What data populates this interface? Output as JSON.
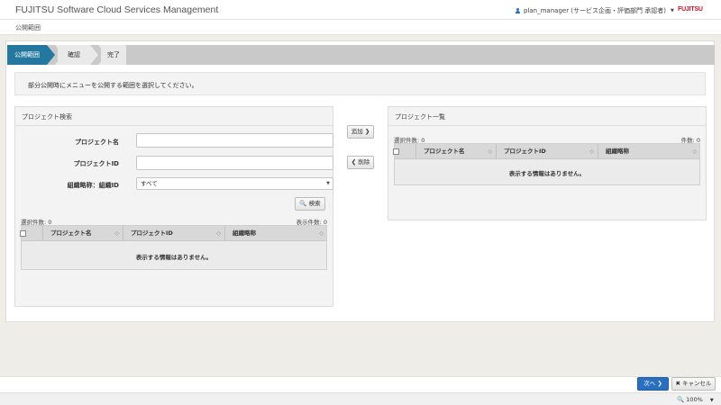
{
  "header": {
    "app_title": "FUJITSU Software Cloud Services Management",
    "user": "plan_manager (サービス企画・評価部門 承認者)",
    "logo": "FUJITSU"
  },
  "breadcrumb": "公開範囲",
  "steps": [
    "公開範囲",
    "確認",
    "完了"
  ],
  "instruction": "部分公開時にメニューを公開する範囲を選択してください。",
  "search_panel": {
    "title": "プロジェクト検索",
    "project_name_label": "プロジェクト名",
    "project_id_label": "プロジェクトID",
    "org_label": "組織略称：組織ID",
    "org_value": "すべて",
    "search_button": "検索",
    "selected_count": "選択件数: 0",
    "display_count": "表示件数: 0",
    "columns": [
      "プロジェクト名",
      "プロジェクトID",
      "組織略称"
    ],
    "empty_message": "表示する情報はありません。"
  },
  "actions": {
    "add": "追加",
    "remove": "削除"
  },
  "list_panel": {
    "title": "プロジェクト一覧",
    "selected_count": "選択件数: 0",
    "total_count": "件数: 0",
    "columns": [
      "プロジェクト名",
      "プロジェクトID",
      "組織略称"
    ],
    "empty_message": "表示する情報はありません。"
  },
  "footer": {
    "next": "次へ",
    "cancel": "キャンセル"
  },
  "status": {
    "zoom": "100%"
  },
  "colors": {
    "accent": "#24789f",
    "primary_button": "#2a6fbf",
    "logo": "#d0112b"
  },
  "icons": [
    "user-icon",
    "search-icon",
    "chevron-right-icon",
    "chevron-left-icon",
    "close-icon",
    "zoom-icon"
  ]
}
